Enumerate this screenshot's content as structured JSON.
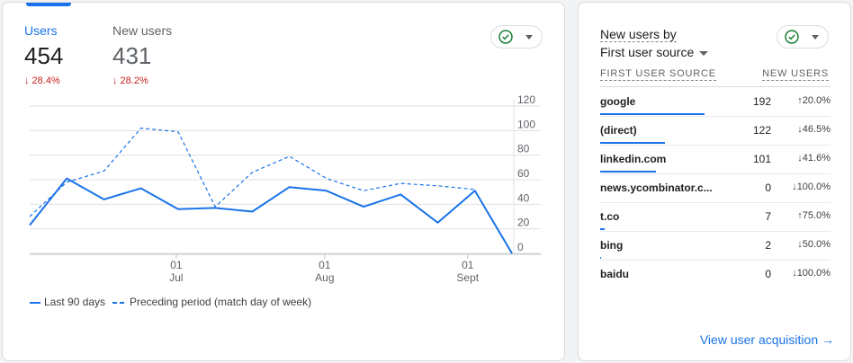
{
  "overview": {
    "metrics": [
      {
        "label": "Users",
        "value": "454",
        "delta": "↓ 28.4%",
        "active": true
      },
      {
        "label": "New users",
        "value": "431",
        "delta": "↓ 28.2%",
        "active": false
      }
    ]
  },
  "chart_data": {
    "type": "line",
    "x_ticks": [
      {
        "day": "01",
        "month": "Jul"
      },
      {
        "day": "01",
        "month": "Aug"
      },
      {
        "day": "01",
        "month": "Sept"
      }
    ],
    "y_ticks": [
      0,
      20,
      40,
      60,
      80,
      100,
      120
    ],
    "ylim": [
      0,
      120
    ],
    "legend_position": "bottom",
    "grid": true,
    "series": [
      {
        "name": "Last 90 days",
        "style": "solid",
        "values": [
          23,
          61,
          44,
          53,
          36,
          37,
          34,
          54,
          51,
          38,
          48,
          25,
          51,
          0
        ]
      },
      {
        "name": "Preceding period (match day of week)",
        "style": "dashed",
        "values": [
          30,
          58,
          67,
          102,
          99,
          38,
          66,
          79,
          61,
          51,
          57,
          55,
          52
        ]
      }
    ],
    "color": "#1a73e8"
  },
  "acquisition": {
    "title_line1": "New users by",
    "dimension": "First user source",
    "col_source": "FIRST USER SOURCE",
    "col_value": "NEW USERS",
    "rows": [
      {
        "source": "google",
        "value": "192",
        "change": "↑20.0%",
        "trend": "up",
        "share": 0.47
      },
      {
        "source": "(direct)",
        "value": "122",
        "change": "↓46.5%",
        "trend": "down",
        "share": 0.29
      },
      {
        "source": "linkedin.com",
        "value": "101",
        "change": "↓41.6%",
        "trend": "down",
        "share": 0.25
      },
      {
        "source": "news.ycombinator.c...",
        "value": "0",
        "change": "↓100.0%",
        "trend": "down",
        "share": 0
      },
      {
        "source": "t.co",
        "value": "7",
        "change": "↑75.0%",
        "trend": "up",
        "share": 0.02
      },
      {
        "source": "bing",
        "value": "2",
        "change": "↓50.0%",
        "trend": "down",
        "share": 0.005
      },
      {
        "source": "baidu",
        "value": "0",
        "change": "↓100.0%",
        "trend": "down",
        "share": 0
      }
    ],
    "link_label": "View user acquisition →"
  }
}
